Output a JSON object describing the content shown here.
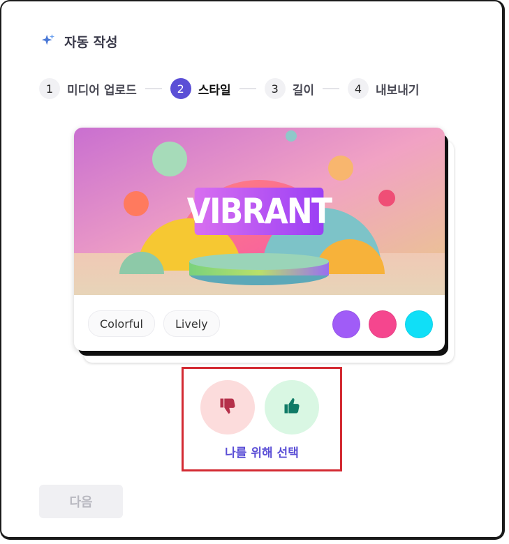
{
  "header": {
    "title": "자동 작성",
    "icon": "sparkle-icon"
  },
  "steps": [
    {
      "num": "1",
      "label": "미디어 업로드",
      "active": false
    },
    {
      "num": "2",
      "label": "스타일",
      "active": true
    },
    {
      "num": "3",
      "label": "길이",
      "active": false
    },
    {
      "num": "4",
      "label": "내보내기",
      "active": false
    }
  ],
  "style_card": {
    "title": "VIBRANT",
    "tags": [
      "Colorful",
      "Lively"
    ],
    "swatches": [
      "#a05cf7",
      "#f5468e",
      "#10dff7"
    ]
  },
  "feedback": {
    "dislike_icon": "thumbs-down-icon",
    "like_icon": "thumbs-up-icon",
    "pick_label": "나를 위해 선택"
  },
  "footer": {
    "next_label": "다음"
  },
  "colors": {
    "accent": "#5b4fd6",
    "highlight_box": "#d32a32"
  }
}
